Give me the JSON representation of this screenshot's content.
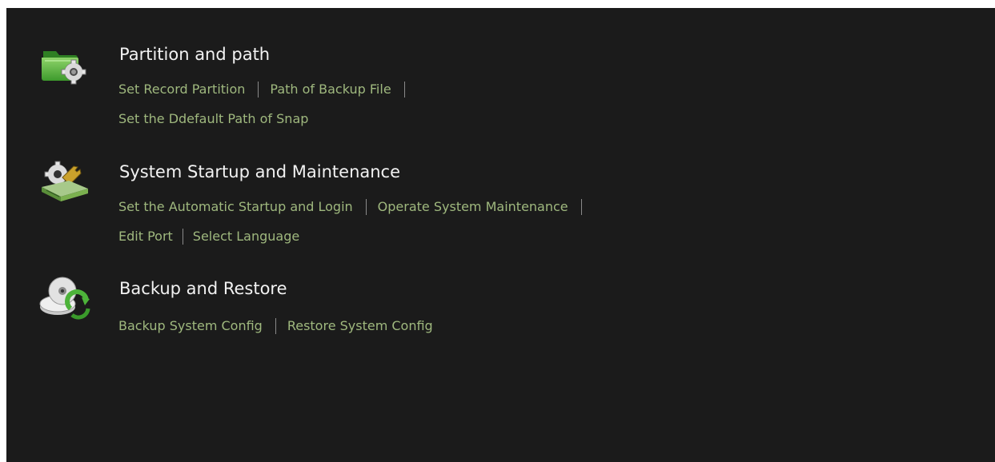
{
  "sections": [
    {
      "title": "Partition and path",
      "icon": "folder-gear-icon",
      "links": [
        "Set Record Partition",
        "Path of Backup File",
        "Set the Ddefault Path of Snap"
      ]
    },
    {
      "title": "System Startup and Maintenance",
      "icon": "gear-wrench-icon",
      "links": [
        "Set the Automatic Startup and Login",
        "Operate System Maintenance",
        "Edit Port",
        "Select Language"
      ]
    },
    {
      "title": "Backup and Restore",
      "icon": "disc-restore-icon",
      "links": [
        "Backup System Config",
        "Restore System Config"
      ]
    }
  ],
  "colors": {
    "background": "#1b1b1b",
    "title": "#f2f2f2",
    "link": "#9fb87e",
    "separator": "#8a8a8a"
  }
}
